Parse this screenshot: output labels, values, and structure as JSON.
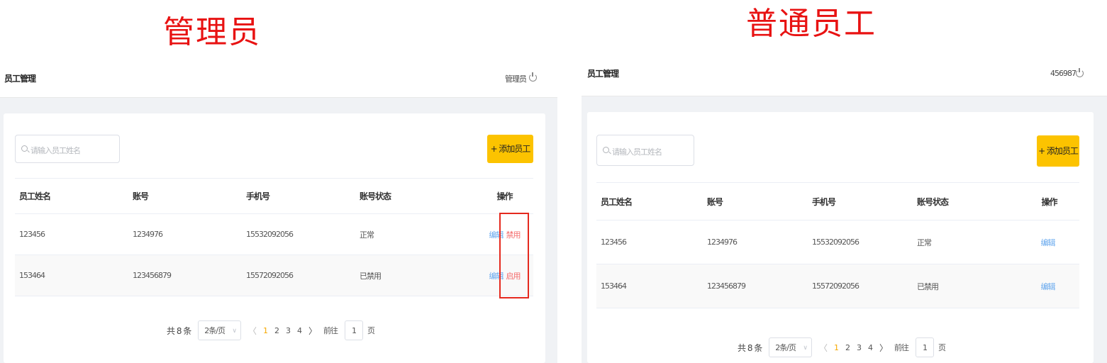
{
  "captions": {
    "admin": "管理员",
    "staff": "普通员工"
  },
  "admin_view": {
    "header": {
      "title": "员工管理",
      "user": "管理员"
    },
    "search": {
      "placeholder": "请输入员工姓名"
    },
    "add_button": "+ 添加员工",
    "table": {
      "columns": [
        "员工姓名",
        "账号",
        "手机号",
        "账号状态",
        "操作"
      ],
      "rows": [
        {
          "name": "123456",
          "account": "1234976",
          "phone": "15532092056",
          "status": "正常",
          "edit": "编辑",
          "toggle": "禁用"
        },
        {
          "name": "153464",
          "account": "123456879",
          "phone": "15572092056",
          "status": "已禁用",
          "edit": "编辑",
          "toggle": "启用"
        }
      ]
    },
    "pagination": {
      "total": "共 8 条",
      "page_size": "2条/页",
      "prev": "〈",
      "pages": [
        "1",
        "2",
        "3",
        "4"
      ],
      "next": "〉",
      "goto_prefix": "前往",
      "goto_value": "1",
      "goto_suffix": "页"
    }
  },
  "staff_view": {
    "header": {
      "title": "员工管理",
      "user": "456987"
    },
    "search": {
      "placeholder": "请输入员工姓名"
    },
    "add_button": "+ 添加员工",
    "table": {
      "columns": [
        "员工姓名",
        "账号",
        "手机号",
        "账号状态",
        "操作"
      ],
      "rows": [
        {
          "name": "123456",
          "account": "1234976",
          "phone": "15532092056",
          "status": "正常",
          "edit": "编辑"
        },
        {
          "name": "153464",
          "account": "123456879",
          "phone": "15572092056",
          "status": "已禁用",
          "edit": "编辑"
        }
      ]
    },
    "pagination": {
      "total": "共 8 条",
      "page_size": "2条/页",
      "prev": "〈",
      "pages": [
        "1",
        "2",
        "3",
        "4"
      ],
      "next": "〉",
      "goto_prefix": "前往",
      "goto_value": "1",
      "goto_suffix": "页"
    }
  },
  "icons": {
    "search": "search-icon",
    "power": "power-icon",
    "caret": "chevron-down-icon"
  },
  "colors": {
    "caption": "#e81212",
    "accent": "#fcc300",
    "link": "#66a8ee",
    "danger": "#f46c6c",
    "active_page": "#f6a800",
    "highlight_box": "#e5291e"
  }
}
